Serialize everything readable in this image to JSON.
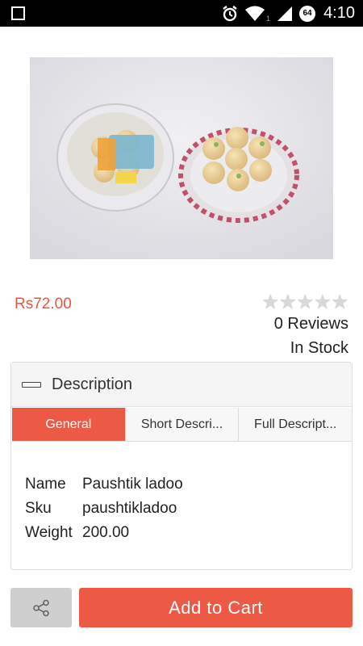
{
  "status_bar": {
    "time": "4:10",
    "battery_level": "64",
    "signal_sub": "1",
    "icons": [
      "notification-square-icon",
      "alarm-icon",
      "wifi-icon",
      "signal-icon",
      "battery-icon"
    ]
  },
  "product": {
    "image_icon": "product-photo",
    "price": "Rs72.00",
    "rating": 0,
    "rating_max": 5,
    "reviews": "0 Reviews",
    "stock": "In Stock"
  },
  "description": {
    "title": "Description",
    "tabs": [
      {
        "label": "General",
        "active": true
      },
      {
        "label": "Short Descri...",
        "active": false
      },
      {
        "label": "Full Descript...",
        "active": false
      }
    ],
    "rows": [
      {
        "key": "Name",
        "value": "Paushtik ladoo"
      },
      {
        "key": "Sku",
        "value": "paushtikladoo"
      },
      {
        "key": "Weight",
        "value": "200.00"
      }
    ]
  },
  "actions": {
    "share_icon": "share-icon",
    "add_to_cart": "Add to Cart"
  },
  "colors": {
    "accent": "#ec5a45",
    "price": "#e8553e"
  }
}
